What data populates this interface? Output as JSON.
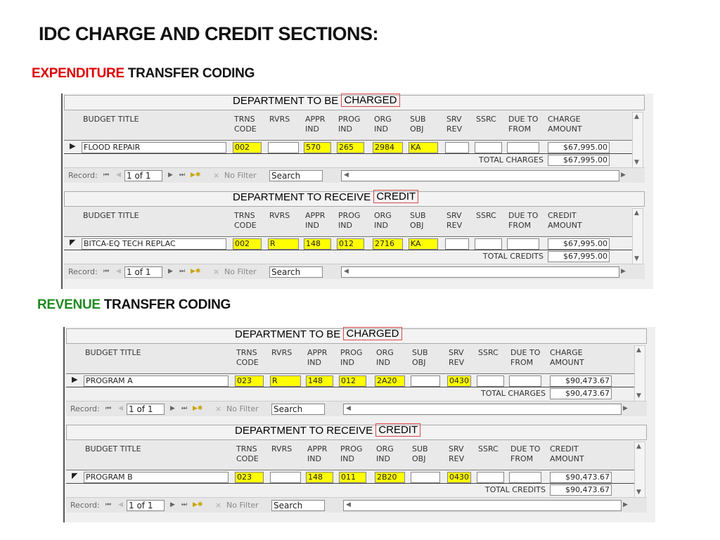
{
  "title": "IDC CHARGE AND CREDIT SECTIONS:",
  "sections": [
    {
      "highlight": "EXPENDITURE",
      "rest": " TRANSFER CODING",
      "color": "#e00000"
    },
    {
      "highlight": "REVENUE",
      "rest": " TRANSFER CODING",
      "color": "#1f8a1f"
    }
  ],
  "forms": [
    {
      "subs": [
        {
          "title": "DEPARTMENT TO BE ",
          "title_hl": "CHARGED",
          "last_col": "CHARGE\nAMOUNT",
          "total_label": "TOTAL CHARGES",
          "row": {
            "marker": "▶",
            "budget": "FLOOD REPAIR",
            "trns": "002",
            "rvrs": "",
            "appr": "570",
            "prog": "265",
            "org": "2984",
            "sub": "KA",
            "srv": "",
            "ssrc": "",
            "due": "",
            "amount": "$67,995.00"
          },
          "total": "$67,995.00"
        },
        {
          "title": "DEPARTMENT TO RECEIVE ",
          "title_hl": "CREDIT",
          "last_col": "CREDIT\nAMOUNT",
          "total_label": "TOTAL CREDITS",
          "row": {
            "marker": "◤",
            "budget": "BITCA-EQ TECH REPLAC",
            "trns": "002",
            "rvrs": "R",
            "appr": "148",
            "prog": "012",
            "org": "2716",
            "sub": "KA",
            "srv": "",
            "ssrc": "",
            "due": "",
            "amount": "$67,995.00"
          },
          "total": "$67,995.00"
        }
      ]
    },
    {
      "subs": [
        {
          "title": "DEPARTMENT TO BE ",
          "title_hl": "CHARGED",
          "last_col": "CHARGE\nAMOUNT",
          "total_label": "TOTAL CHARGES",
          "row": {
            "marker": "▶",
            "budget": "PROGRAM A",
            "trns": "023",
            "rvrs": "R",
            "appr": "148",
            "prog": "012",
            "org": "2A20",
            "sub": "",
            "srv": "0430",
            "ssrc": "",
            "due": "",
            "amount": "$90,473.67"
          },
          "total": "$90,473.67"
        },
        {
          "title": "DEPARTMENT TO RECEIVE ",
          "title_hl": "CREDIT",
          "last_col": "CREDIT\nAMOUNT",
          "total_label": "TOTAL CREDITS",
          "row": {
            "marker": "◤",
            "budget": "PROGRAM B",
            "trns": "023",
            "rvrs": "",
            "appr": "148",
            "prog": "011",
            "org": "2B20",
            "sub": "",
            "srv": "0430",
            "ssrc": "",
            "due": "",
            "amount": "$90,473.67"
          },
          "total": "$90,473.67"
        }
      ]
    }
  ],
  "columns": {
    "budget": "BUDGET TITLE",
    "trns": "TRNS\nCODE",
    "rvrs": "RVRS",
    "appr": "APPR\nIND",
    "prog": "PROG\nIND",
    "org": "ORG\nIND",
    "sub": "SUB\nOBJ",
    "srv": "SRV\nREV",
    "ssrc": "SSRC",
    "due": "DUE TO\nFROM"
  },
  "nav": {
    "record_label": "Record:",
    "position": "1 of 1",
    "filter": "No Filter",
    "search": "Search"
  },
  "colors": {
    "field_highlight": "#ffff00",
    "title_box": "#d94848"
  }
}
